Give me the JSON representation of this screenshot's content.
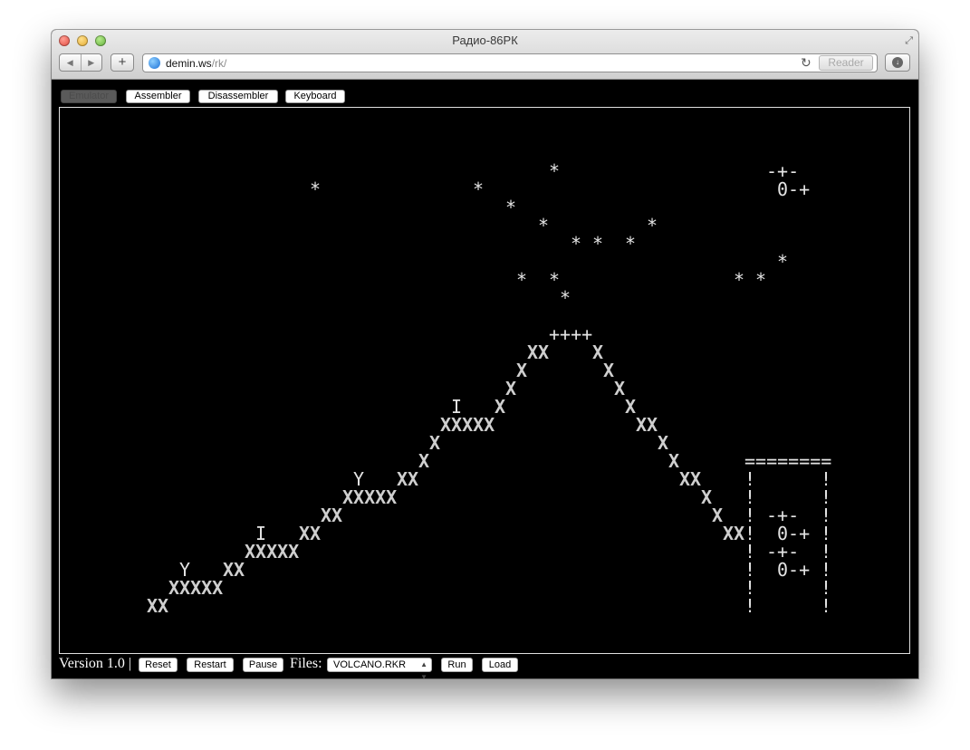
{
  "window": {
    "title": "Радио-86РК"
  },
  "toolbar": {
    "url_host": "demin.ws",
    "url_path": "/rk/",
    "reader_label": "Reader"
  },
  "tabs": [
    {
      "label": "Emulator",
      "disabled": true
    },
    {
      "label": "Assembler",
      "disabled": false
    },
    {
      "label": "Disassembler",
      "disabled": false
    },
    {
      "label": "Keyboard",
      "disabled": false
    }
  ],
  "screen_text": {
    "stars": "*",
    "cloud_top": "-+-",
    "cloud_bottom": "0-+",
    "crater": "++++",
    "xx": "XX",
    "x": "X",
    "xxxxx": "XXXXX",
    "letter_y": "Y",
    "letter_i": "I",
    "hut_roof": "========",
    "bar": "!"
  },
  "status": {
    "version": "Version 1.0 |",
    "reset": "Reset",
    "restart": "Restart",
    "pause": "Pause",
    "files_label": "Files:",
    "file_selected": "VOLCANO.RKR",
    "run": "Run",
    "load": "Load"
  },
  "icons": {
    "back": "back-arrow-icon",
    "forward": "forward-arrow-icon",
    "new_tab": "plus-icon",
    "site": "globe-icon",
    "reload": "reload-icon",
    "download": "download-icon",
    "fullscreen": "fullscreen-icon"
  }
}
